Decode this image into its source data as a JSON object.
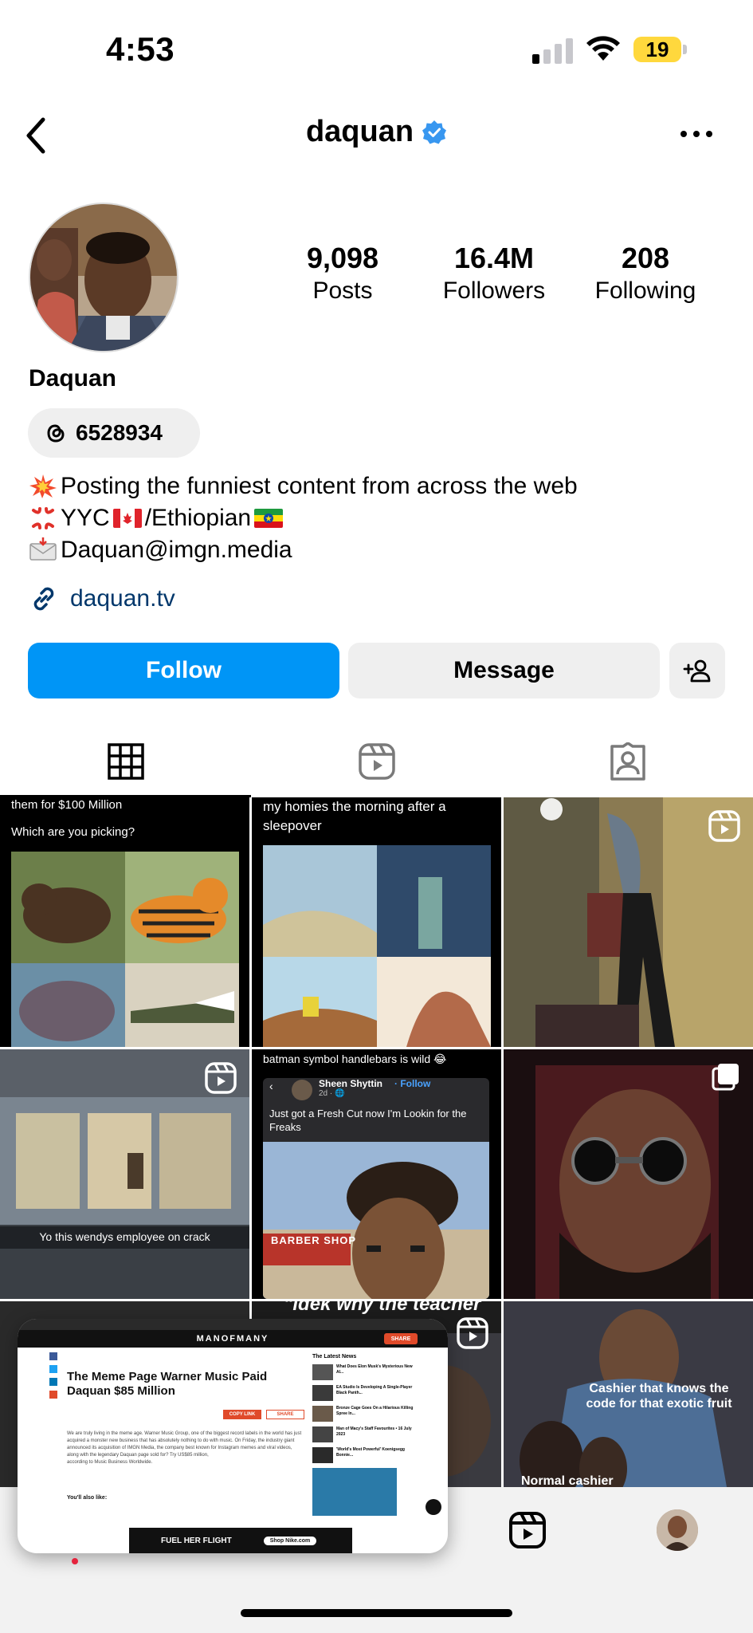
{
  "status_bar": {
    "time": "4:53",
    "battery": "19"
  },
  "header": {
    "username": "daquan"
  },
  "profile": {
    "stats": [
      {
        "value": "9,098",
        "label": "Posts"
      },
      {
        "value": "16.4M",
        "label": "Followers"
      },
      {
        "value": "208",
        "label": "Following"
      }
    ],
    "display_name": "Daquan",
    "threads_handle": "6528934",
    "bio": {
      "line1": "Posting the funniest content from across the web",
      "line2_a": "YYC",
      "line2_b": "/Ethiopian",
      "line3": "Daquan@imgn.media"
    },
    "link": "daquan.tv"
  },
  "actions": {
    "follow": "Follow",
    "message": "Message"
  },
  "grid": {
    "t1_caption_a": "them for $100 Million",
    "t1_caption_b": "Which are you picking?",
    "t2_caption": "my homies the morning after a sleepover",
    "t4_caption": "Yo this wendys employee on crack",
    "t5_caption": "batman symbol handlebars is wild 😂",
    "t5_post_name": "Sheen Shyttin",
    "t5_post_follow": "· Follow",
    "t5_post_meta": "2d · 🌐",
    "t5_post_text": "Just got a Fresh Cut now I'm Lookin for the Freaks",
    "t5_shop_sign": "BARBER SHOP",
    "t8_caption": "\"idek why the teacher",
    "t9_caption": "Cashier that knows the code for that exotic fruit",
    "t9_caption_b": "Normal cashier"
  },
  "pip": {
    "site": "MANOFMANY",
    "headline": "The Meme Page Warner Music Paid Daquan $85 Million",
    "sidebar_title": "The Latest News",
    "side_items": [
      "What Does Elon Musk's Mysterious New AI...",
      "EA Studio Is Developing A Single-Player Black Panth...",
      "Bronze Cage Goes On a Hilarious Killing Spree In...",
      "Man of Macy's Staff Favourites • 16 July 2023",
      "'World's Most Powerful' Koenigsegg Bonnie..."
    ],
    "body_lines": [
      "We are truly living in the meme age. Warner Music Group, one of the biggest record labels in the world has just",
      "acquired a monster new business that has absolutely nothing to do with music. On Friday, the industry giant",
      "announced its acquisition of IMGN Media, the company best known for Instagram memes and viral videos,",
      "along with the legendary Daquan page sold for? Try US$85 million,",
      "according to Music Business Worldwide."
    ],
    "also_like": "You'll also like:",
    "ad_text": "FUEL HER FLIGHT",
    "ad_cta": "Shop Nike.com",
    "copy_link": "COPY LINK",
    "share": "SHARE"
  }
}
